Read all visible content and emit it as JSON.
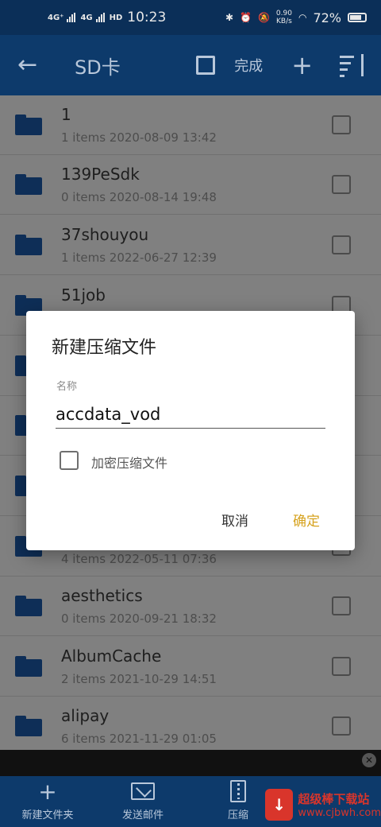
{
  "status_bar": {
    "signal1": "4G⁺",
    "signal2": "4G",
    "hd": "HD",
    "time": "10:23",
    "speed": "0.90",
    "speed_unit": "KB/s",
    "battery": "72%"
  },
  "toolbar": {
    "title": "SD卡",
    "done_label": "完成",
    "plus_label": "+"
  },
  "files": [
    {
      "name": "1",
      "meta": "1 items 2020-08-09 13:42"
    },
    {
      "name": "139PeSdk",
      "meta": "0 items 2020-08-14 19:48"
    },
    {
      "name": "37shouyou",
      "meta": "1 items 2022-06-27 12:39"
    },
    {
      "name": "51job",
      "meta": ""
    },
    {
      "name": "",
      "meta": ""
    },
    {
      "name": "",
      "meta": ""
    },
    {
      "name": "",
      "meta": ""
    },
    {
      "name": "",
      "meta": "4 items 2022-05-11 07:36"
    },
    {
      "name": "aesthetics",
      "meta": "0 items 2020-09-21 18:32"
    },
    {
      "name": "AlbumCache",
      "meta": "2 items 2021-10-29 14:51"
    },
    {
      "name": "alipay",
      "meta": "6 items 2021-11-29 01:05"
    }
  ],
  "dialog": {
    "title": "新建压缩文件",
    "field_label": "名称",
    "field_value": "accdata_vod",
    "checkbox_label": "加密压缩文件",
    "cancel": "取消",
    "confirm": "确定"
  },
  "bottom_bar": {
    "new_folder": "新建文件夹",
    "send_mail": "发送邮件",
    "compress": "压缩"
  },
  "watermark": {
    "line1": "超级棒下载站",
    "line2": "www.cjbwh.com"
  },
  "colors": {
    "toolbar": "#0d3a6b",
    "accent": "#d6a21e"
  }
}
